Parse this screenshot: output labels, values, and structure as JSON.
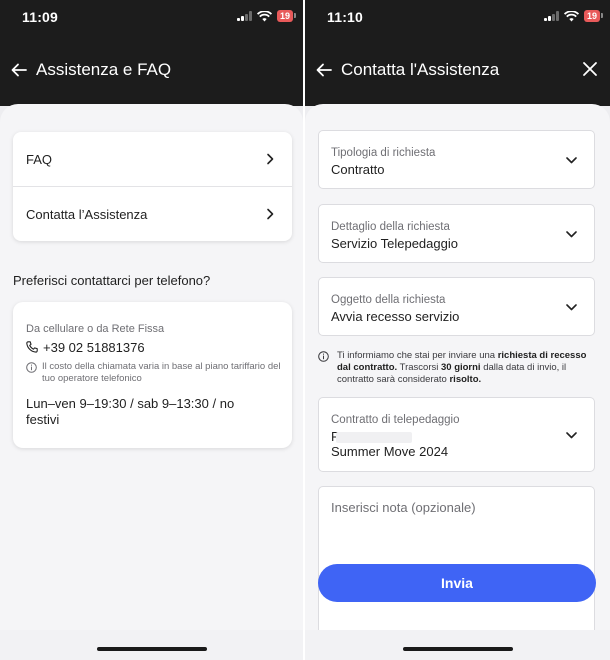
{
  "left": {
    "status": {
      "time": "11:09",
      "battery": "19"
    },
    "header": {
      "title": "Assistenza e FAQ"
    },
    "menu": [
      {
        "label": "FAQ"
      },
      {
        "label": "Contatta l’Assistenza"
      }
    ],
    "phone_question": "Preferisci contattarci per telefono?",
    "contact": {
      "source": "Da cellulare o da Rete Fissa",
      "number": "+39 02 51881376",
      "cost_note": "Il costo della chiamata varia in base al piano tariffario del tuo operatore telefonico",
      "hours": "Lun–ven 9–19:30 / sab 9–13:30 / no festivi"
    }
  },
  "right": {
    "status": {
      "time": "11:10",
      "battery": "19"
    },
    "header": {
      "title": "Contatta l'Assistenza"
    },
    "fields": {
      "tipologia": {
        "label": "Tipologia di richiesta",
        "value": "Contratto"
      },
      "dettaglio": {
        "label": "Dettaglio della richiesta",
        "value": "Servizio Telepedaggio"
      },
      "oggetto": {
        "label": "Oggetto della richiesta",
        "value": "Avvia recesso servizio"
      },
      "contratto": {
        "label": "Contratto di telepedaggio",
        "value_line1": "F",
        "value_line2": "Summer Move 2024"
      },
      "nota": {
        "placeholder": "Inserisci nota (opzionale)"
      }
    },
    "info": {
      "part1": "Ti informiamo che stai per inviare una ",
      "bold1": "richiesta di recesso dal contratto.",
      "part2": " Trascorsi ",
      "bold2": "30 giorni",
      "part3": " dalla data di invio, il contratto sarà considerato ",
      "bold3": "risolto."
    },
    "submit_label": "Invia"
  },
  "colors": {
    "accent": "#3f64f5",
    "header_bg": "#1c1c1c",
    "battery": "#e85a5a"
  }
}
